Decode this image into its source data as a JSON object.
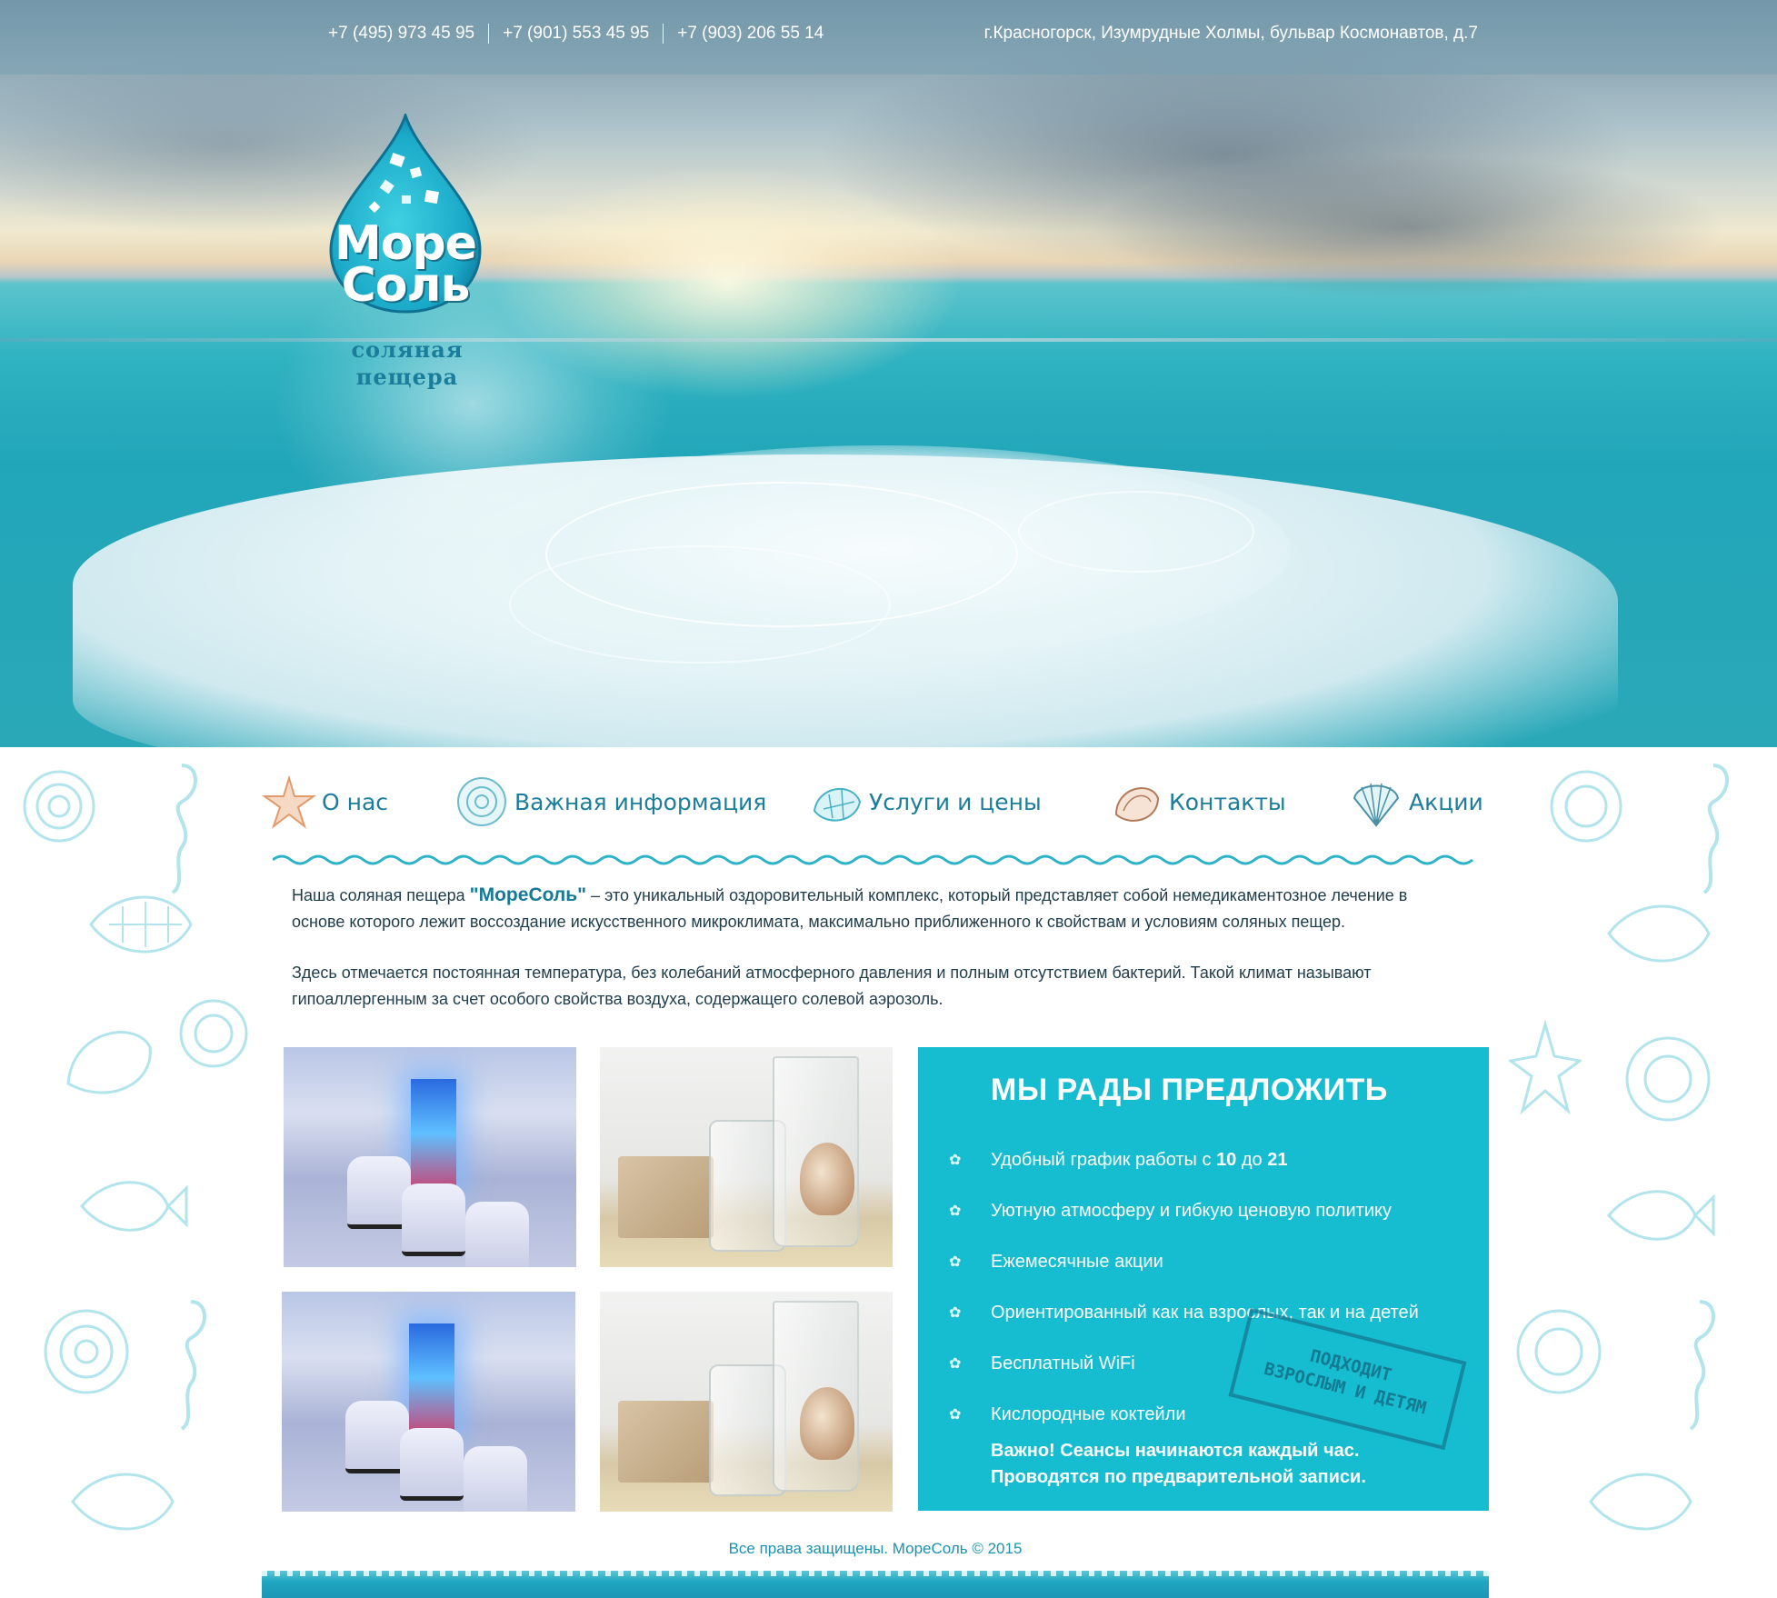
{
  "header": {
    "phones": [
      "+7 (495) 973 45 95",
      "+7 (901) 553 45 95",
      "+7 (903) 206 55 14"
    ],
    "address": "г.Красногорск, Изумрудные Холмы, бульвар Космонавтов, д.7"
  },
  "logo": {
    "line1": "Море",
    "line2": "Соль",
    "subtitle_line1": "соляная",
    "subtitle_line2": "пещера"
  },
  "nav": [
    {
      "label": "О нас",
      "icon": "starfish-icon"
    },
    {
      "label": "Важная информация",
      "icon": "ammonite-shell-icon"
    },
    {
      "label": "Услуги и цены",
      "icon": "conch-shell-icon"
    },
    {
      "label": "Контакты",
      "icon": "spiral-shell-icon"
    },
    {
      "label": "Акции",
      "icon": "scallop-shell-icon"
    }
  ],
  "intro": {
    "p1_before": "Наша соляная пещера",
    "p1_brand": "\"МореСоль\"",
    "p1_after": "– это уникальный оздоровительный комплекс, который представляет собой немедикаментозное лечение в основе которого лежит воссоздание искусственного микроклимата, максимально приближенного к свойствам и условиям соляных пещер.",
    "p2": "Здесь отмечается постоянная температура, без колебаний атмосферного давления и полным отсутствием бактерий. Такой климат называют гипоаллергенным за счет особого свойства воздуха, содержащего солевой аэрозоль."
  },
  "offer": {
    "title": "МЫ РАДЫ ПРЕДЛОЖИТЬ",
    "schedule_prefix": "Удобный график работы с",
    "schedule_from": "10",
    "schedule_mid": "до",
    "schedule_to": "21",
    "items": [
      "Уютную атмосферу и гибкую ценовую политику",
      "Ежемесячные акции",
      "Ориентированный как на взрослых, так и на детей",
      "Бесплатный WiFi",
      "Кислородные коктейли"
    ],
    "important_line1": "Важно! Сеансы начинаются каждый час.",
    "important_line2": "Проводятся по предварительной записи.",
    "stamp_line1": "ПОДХОДИТ",
    "stamp_line2": "ВЗРОСЛЫМ И ДЕТЯМ"
  },
  "footer": {
    "copyright": "Все права защищены. МореСоль © 2015"
  },
  "colors": {
    "accent": "#16bcd0",
    "link": "#1b7e9c",
    "brand_dark": "#157a97"
  }
}
